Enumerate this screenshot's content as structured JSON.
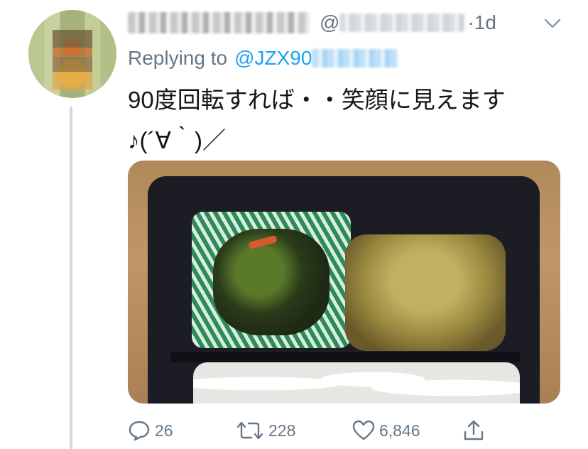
{
  "tweet": {
    "author_name": "",
    "handle_prefix": "@",
    "time": "·1d",
    "replying_to_label": "Replying to",
    "replying_to_handle": "@JZX90",
    "text_lines": [
      "90度回転すれば・・笑顔に見えます",
      "♪(´∀｀)／"
    ]
  },
  "actions": {
    "reply_count": "26",
    "retweet_count": "228",
    "like_count": "6,846"
  },
  "colors": {
    "accent": "#1da1f2",
    "muted": "#657786",
    "text": "#14171a",
    "thread_line": "#cfd9de"
  },
  "icons": {
    "reply": "speech-bubble-icon",
    "retweet": "retweet-arrows-icon",
    "like": "heart-icon",
    "share": "share-upload-icon",
    "menu": "chevron-down-icon"
  }
}
